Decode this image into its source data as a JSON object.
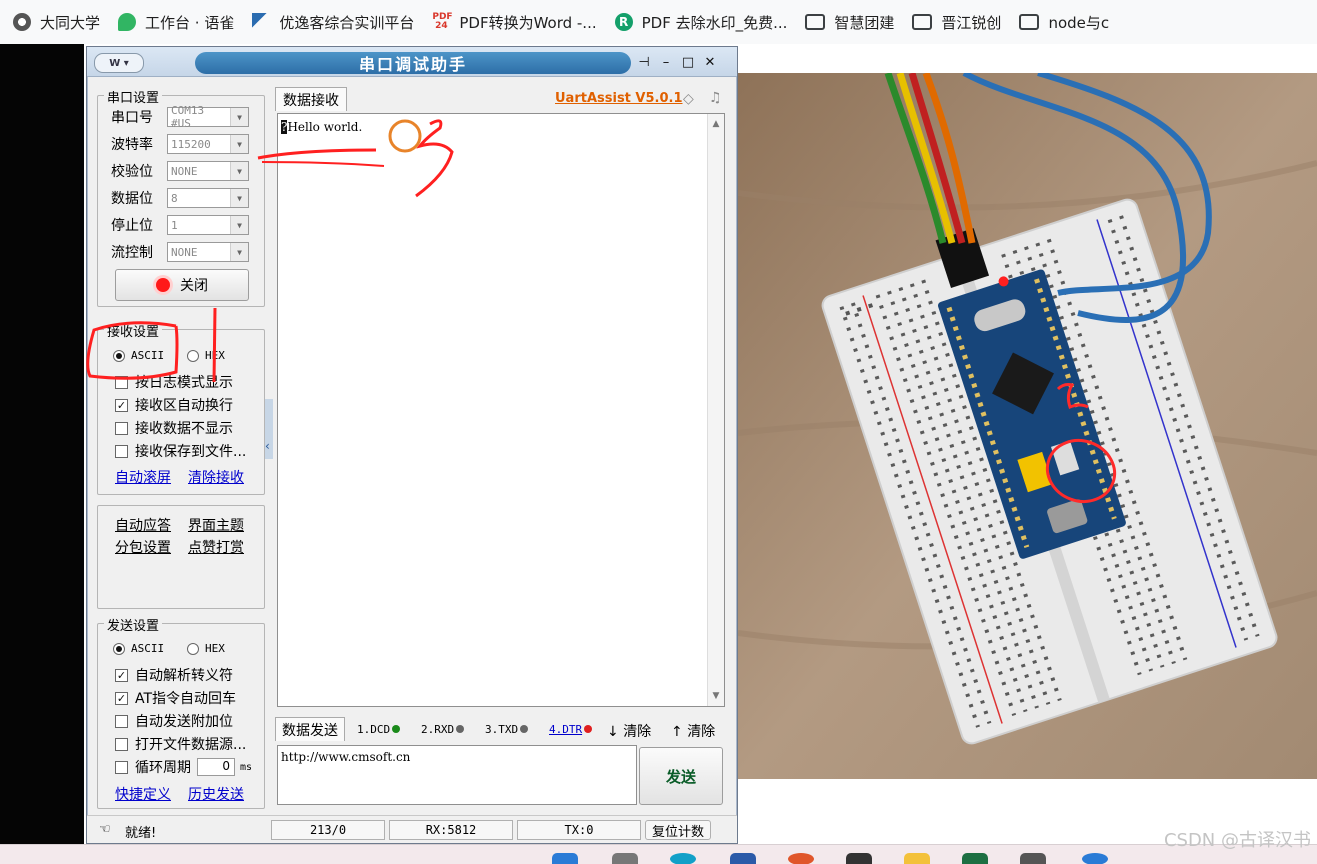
{
  "bookmarks": [
    {
      "label": "大同大学",
      "icon": "gear-favicon",
      "color": "#555555"
    },
    {
      "label": "工作台 · 语雀",
      "icon": "yuque-favicon",
      "color": "#31b563"
    },
    {
      "label": "优逸客综合实训平台",
      "icon": "fish-favicon",
      "color": "#2b6cb0"
    },
    {
      "label": "PDF转换为Word -...",
      "icon": "pdf24-favicon",
      "color": "#d9372b"
    },
    {
      "label": "PDF 去除水印_免费...",
      "icon": "pdf-r-favicon",
      "color": "#14a06a"
    },
    {
      "label": "智慧团建",
      "icon": "folder-icon",
      "color": "#3c4043"
    },
    {
      "label": "晋江锐创",
      "icon": "folder-icon",
      "color": "#3c4043"
    },
    {
      "label": "node与c",
      "icon": "folder-icon",
      "color": "#3c4043"
    }
  ],
  "window": {
    "title": "串口调试助手",
    "sysmenu": "W ▾",
    "logo": "UartAssist V5.0.1"
  },
  "serial": {
    "group_title": "串口设置",
    "port_label": "串口号",
    "port_value": "COM13 #US",
    "baud_label": "波特率",
    "baud_value": "115200",
    "parity_label": "校验位",
    "parity_value": "NONE",
    "databits_label": "数据位",
    "databits_value": "8",
    "stopbits_label": "停止位",
    "stopbits_value": "1",
    "flow_label": "流控制",
    "flow_value": "NONE",
    "close_button": "关闭"
  },
  "receive": {
    "group_title": "接收设置",
    "ascii": "ASCII",
    "hex": "HEX",
    "mode": "ASCII",
    "log_mode": {
      "label": "按日志模式显示",
      "checked": false
    },
    "auto_wrap": {
      "label": "接收区自动换行",
      "checked": true
    },
    "hide_data": {
      "label": "接收数据不显示",
      "checked": false
    },
    "save_to_file": {
      "label": "接收保存到文件...",
      "checked": false
    },
    "auto_scroll": "自动滚屏",
    "clear_receive": "清除接收"
  },
  "extras": {
    "auto_reply": "自动应答",
    "theme": "界面主题",
    "packet": "分包设置",
    "tip": "点赞打赏"
  },
  "send": {
    "group_title": "发送设置",
    "ascii": "ASCII",
    "hex": "HEX",
    "mode": "ASCII",
    "escape": {
      "label": "自动解析转义符",
      "checked": true
    },
    "at_crlf": {
      "label": "AT指令自动回车",
      "checked": true
    },
    "append": {
      "label": "自动发送附加位",
      "checked": false
    },
    "open_file": {
      "label": "打开文件数据源...",
      "checked": false
    },
    "cycle": {
      "label": "循环周期",
      "checked": false,
      "value": "0",
      "unit": "ms"
    },
    "shortcut": "快捷定义",
    "history": "历史发送"
  },
  "rx_panel": {
    "tab": "数据接收",
    "content": "Hello world."
  },
  "tx_panel": {
    "tab": "数据发送",
    "dcd": "1.DCD",
    "rxd": "2.RXD",
    "txd": "3.TXD",
    "dtr": "4.DTR",
    "clear1": "清除",
    "clear2": "清除",
    "content": "http://www.cmsoft.cn",
    "send_button": "发送"
  },
  "status": {
    "ready": "就绪!",
    "count": "213/0",
    "rx": "RX:5812",
    "tx": "TX:0",
    "reset": "复位计数"
  },
  "watermark": "CSDN @古译汉书"
}
